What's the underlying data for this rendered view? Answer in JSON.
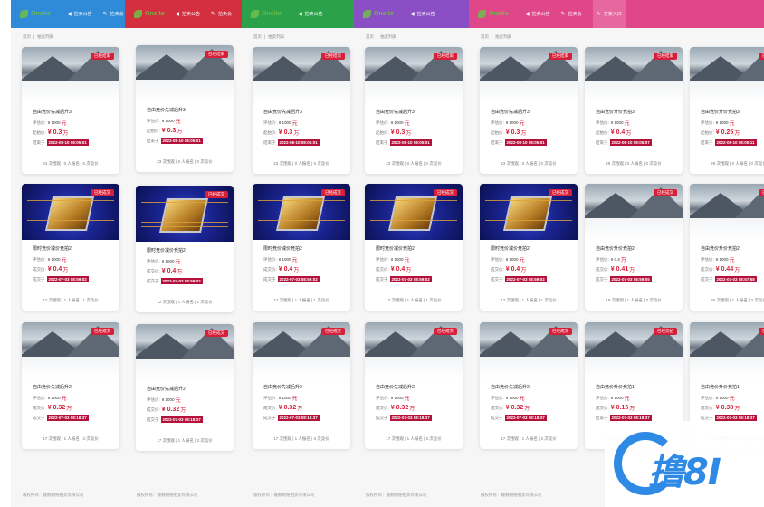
{
  "brand": "Onsite",
  "nav": [
    "拍卖公告",
    "拍卖会",
    "买家入口"
  ],
  "breadcrumb": [
    "首页",
    "拍卖列表"
  ],
  "footer": "版权所有：靓靓网络拍卖有限公司",
  "colors": {
    "topbar": [
      "#2f8ad8",
      "#d42f3f",
      "#2ba24a",
      "#8a4fc4",
      "#e0478a"
    ],
    "tag": "#d6203a",
    "price": "#d6203a",
    "date_bg": "#b5123b",
    "watermark": "#2f8ae5"
  },
  "cards": [
    {
      "image": "snow",
      "tag": "已经结束",
      "title": "自由竞价先减后升3",
      "r1_label": "评估价:",
      "r1_value": "¥ 1000",
      "r1_unit": "元",
      "r2_label": "起拍价:",
      "r2_value": "¥ 0.3",
      "r2_unit": "万",
      "r3_label": "结束于",
      "r3_date": "2022-08-10 08:05:01",
      "stats": "23 次围观 | 0 人报名 | 0 次竞价"
    },
    {
      "image": "chip",
      "tag": "已经成交",
      "title": "限时竞价减价竞拍2",
      "r1_label": "评估价:",
      "r1_value": "¥ 1000",
      "r1_unit": "元",
      "r2_label": "成交价:",
      "r2_value": "¥ 0.4",
      "r2_unit": "万",
      "r3_label": "成交于",
      "r3_date": "2022-07-03 08:59:02",
      "stats": "12 次围观 | 1 人报名 | 1 次竞价"
    },
    {
      "image": "snow",
      "tag": "已经成交",
      "title": "自由竞价先减后升2",
      "r1_label": "评估价:",
      "r1_value": "¥ 1000",
      "r1_unit": "元",
      "r2_label": "成交价:",
      "r2_value": "¥ 0.32",
      "r2_unit": "万",
      "r3_label": "成交于",
      "r3_date": "2022-07-03 08:18:37",
      "stats": "17 次围观 | 1 人报名 | 3 次竞价"
    },
    {
      "image": "snow",
      "tag": "已经结束",
      "title": "自由竞价升价竞拍3",
      "r1_label": "评估价:",
      "r1_value": "¥ 1000",
      "r1_unit": "元",
      "r2_label": "起拍价:",
      "r2_value": "¥ 0.4",
      "r2_unit": "万",
      "r3_label": "结束于",
      "r3_date": "2022-08-10 08:05:07",
      "stats": "29 次围观 | 0 人报名 | 0 次竞价"
    },
    {
      "image": "snow",
      "tag": "已经成交",
      "title": "自由竞价升价竞拍2",
      "r1_label": "评估价:",
      "r1_value": "¥ 0.3",
      "r1_unit": "万",
      "r2_label": "成交价:",
      "r2_value": "¥ 0.41",
      "r2_unit": "万",
      "r3_label": "成交于",
      "r3_date": "2022-07-03 08:59:05",
      "stats": "19 次围观 | 1 人报名 | 3 次竞价"
    },
    {
      "image": "snow",
      "tag": "已经流拍",
      "title": "自由竞价升价竞拍1",
      "r1_label": "评估价:",
      "r1_value": "¥ 1000",
      "r1_unit": "元",
      "r2_label": "成交价:",
      "r2_value": "¥ 0.15",
      "r2_unit": "万",
      "r3_label": "结束于",
      "r3_date": "2022-07-03 08:18:37",
      "stats": "9 次围观 | 1 人报名 | 3 次竞价"
    },
    {
      "image": "snow",
      "tag": "已经结束",
      "title": "自由竞价升价竞拍3",
      "r1_label": "评估价:",
      "r1_value": "¥ 1000",
      "r1_unit": "元",
      "r2_label": "起拍价:",
      "r2_value": "¥ 0.25",
      "r2_unit": "万",
      "r3_label": "结束于",
      "r3_date": "2022-08-10 08:05:11",
      "stats": "29 次围观 | 0 人报名 | 0 次竞价"
    },
    {
      "image": "snow",
      "tag": "已经成交",
      "title": "自由竞价升价竞拍2",
      "r1_label": "评估价:",
      "r1_value": "¥ 1000",
      "r1_unit": "元",
      "r2_label": "成交价:",
      "r2_value": "¥ 0.44",
      "r2_unit": "万",
      "r3_label": "成交于",
      "r3_date": "2022-07-03 08:57:58",
      "stats": "26 次围观 | 1 人报名 | 3 次竞价"
    },
    {
      "image": "snow",
      "tag": "已经成交",
      "title": "自由竞价升价竞拍1",
      "r1_label": "评估价:",
      "r1_value": "¥ 1000",
      "r1_unit": "元",
      "r2_label": "成交价:",
      "r2_value": "¥ 0.38",
      "r2_unit": "万",
      "r3_label": "成交于",
      "r3_date": "2022-07-03 08:18:37",
      "stats": "17 次围观 | 1 人报名 | 3 次竞价"
    }
  ],
  "watermark": {
    "text": "撸8I"
  }
}
